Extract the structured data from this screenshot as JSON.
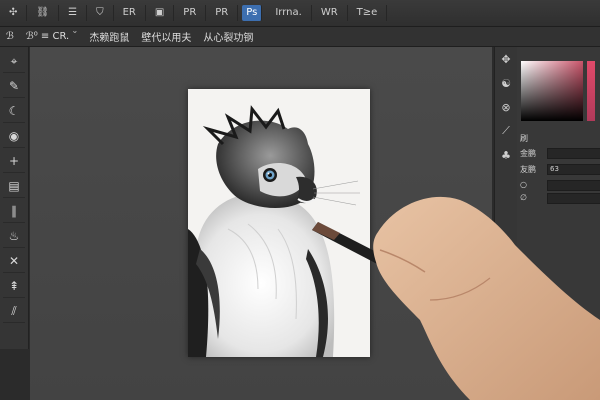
{
  "menu": {
    "items": [
      "✣",
      "⛓",
      "☰",
      "⛉",
      "ER",
      "▣",
      "PR",
      "PR",
      "Ps",
      "Irrna.",
      "WR",
      "T≥e"
    ],
    "active_index": 8
  },
  "options_bar": {
    "preset": "ℬ",
    "items": [
      "ℬ⁰ ≡ CR. ˘",
      "杰赖跑鼠",
      "壁代以用夫",
      "从心裂功钢"
    ]
  },
  "tools": [
    "⌖",
    "✎",
    "☾",
    "◉",
    "+",
    "▤",
    "∥",
    "♨",
    "✕",
    "⇞",
    "⫽"
  ],
  "right_tools": [
    "✥",
    "☯",
    "⊗",
    "⟋",
    "♣"
  ],
  "panel": {
    "label_1": "刷",
    "row_1_label": "金鹏",
    "row_2_label": "友鹏",
    "row_2_value": "63",
    "row_3_label": "○",
    "row_4_label": "∅"
  },
  "colors": {
    "accent": "#3d6fb0",
    "workspace": "#474747",
    "paper": "#f4f3f1"
  }
}
